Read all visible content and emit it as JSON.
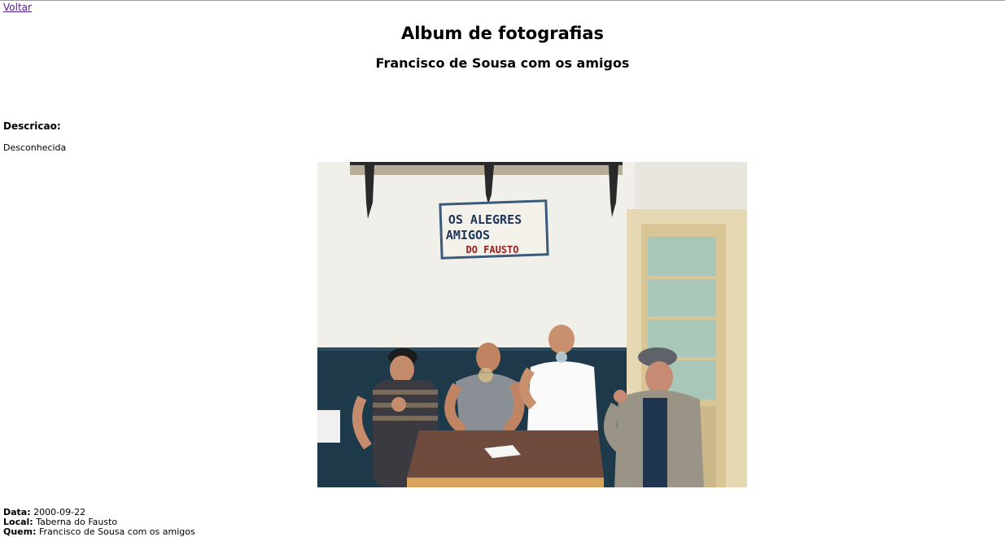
{
  "nav": {
    "back_label": "Voltar"
  },
  "page": {
    "title": "Album de fotografias",
    "subtitle": "Francisco de Sousa com os amigos"
  },
  "description": {
    "label": "Descricao:",
    "value": "Desconhecida"
  },
  "photo": {
    "sign_line1": "OS ALEGRES",
    "sign_line2": "AMIGOS",
    "sign_line3": "DO FAUSTO"
  },
  "details": {
    "date_label": "Data:",
    "date_value": "2000-09-22",
    "place_label": "Local:",
    "place_value": "Taberna do Fausto",
    "who_label": "Quem:",
    "who_value": "Francisco de Sousa com os amigos"
  }
}
